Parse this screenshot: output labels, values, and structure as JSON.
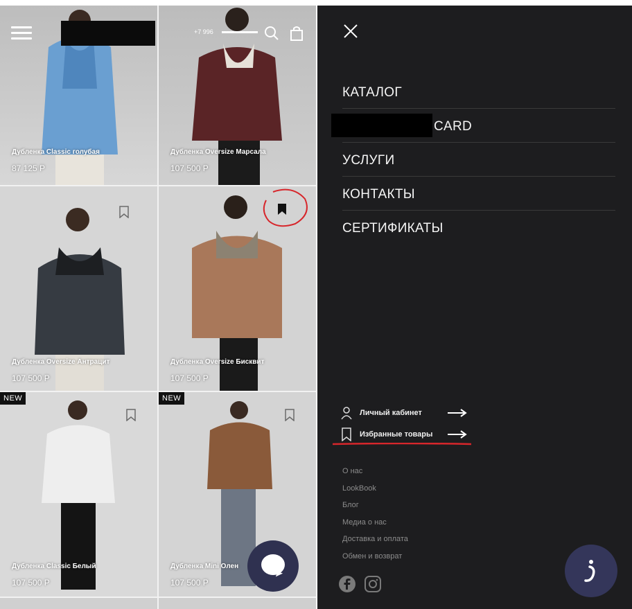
{
  "left": {
    "header": {
      "phone": "+7 996",
      "icons": [
        "menu-icon",
        "search-icon",
        "bag-icon"
      ]
    },
    "products": [
      {
        "name": "Дубленка Classic голубая",
        "price": "87 125 P",
        "bookmarked": false,
        "new": false,
        "coat_color": "#6a9fd1",
        "bg": "#c9c9c9"
      },
      {
        "name": "Дубленка Oversize Марсала",
        "price": "107 500 P",
        "bookmarked": false,
        "new": false,
        "coat_color": "#5a2426",
        "bg": "#c4c4c4"
      },
      {
        "name": "Дубленка Oversize Антрацит",
        "price": "107 500 P",
        "bookmarked": false,
        "new": false,
        "coat_color": "#363b42",
        "bg": "#d6d6d6"
      },
      {
        "name": "Дубленка Oversize Бисквит",
        "price": "107 500 P",
        "bookmarked": true,
        "new": false,
        "coat_color": "#a9785a",
        "bg": "#d3d3d3"
      },
      {
        "name": "Дубленка Classic Белый",
        "price": "107 500 P",
        "bookmarked": false,
        "new": true,
        "badge": "NEW",
        "coat_color": "#eeeeee",
        "bg": "#d9d9d9"
      },
      {
        "name": "Дубленка Mini Олен",
        "price": "107 500 P",
        "bookmarked": false,
        "new": true,
        "badge": "NEW",
        "coat_color": "#8a5a3a",
        "bg": "#d4d4d4"
      }
    ]
  },
  "right": {
    "menu": [
      {
        "label": "КАТАЛОГ"
      },
      {
        "label": "CARD"
      },
      {
        "label": "УСЛУГИ"
      },
      {
        "label": "КОНТАКТЫ"
      },
      {
        "label": "СЕРТИФИКАТЫ"
      }
    ],
    "account": {
      "cabinet": "Личный кабинет",
      "favorites": "Избранные товары"
    },
    "links": [
      "О нас",
      "LookBook",
      "Блог",
      "Медиа о нас",
      "Доставка и оплата",
      "Обмен и возврат"
    ],
    "social": [
      "facebook-icon",
      "instagram-icon"
    ],
    "colors": {
      "panel": "#1d1d1f",
      "annotation": "#d7262b",
      "fab": "#34365a"
    }
  }
}
